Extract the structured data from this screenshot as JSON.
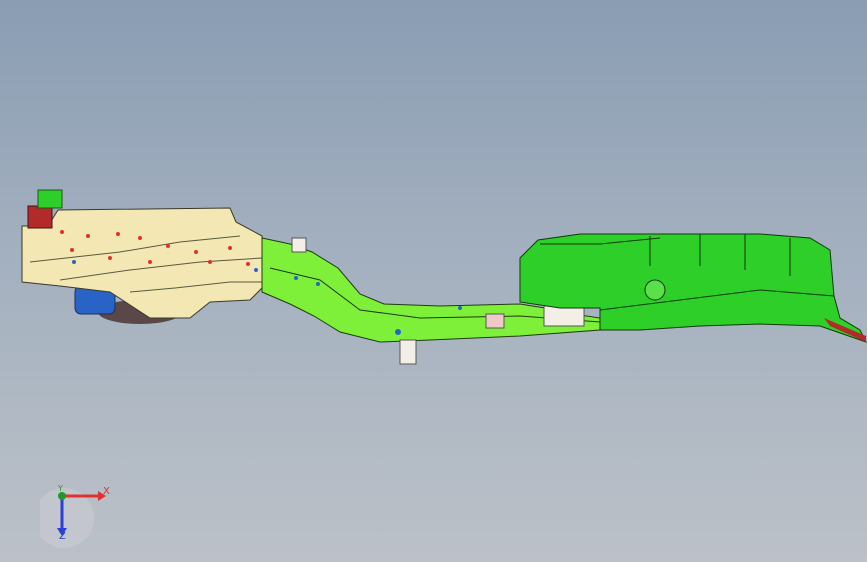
{
  "viewport": {
    "title": "",
    "background_top": "#8a9db3",
    "background_bottom": "#bcc1c8"
  },
  "model": {
    "front_section_color": "#f3e7b4",
    "center_section_color": "#7ef03a",
    "rear_section_color": "#2fcf2a",
    "bracket_color": "#b22a2a",
    "mount_color": "#2a63c6"
  },
  "triad": {
    "x_label": "X",
    "y_label": "Y",
    "z_label": "Z",
    "x_color": "#e03030",
    "y_color": "#1f9a2a",
    "z_color": "#2b3fd6"
  }
}
